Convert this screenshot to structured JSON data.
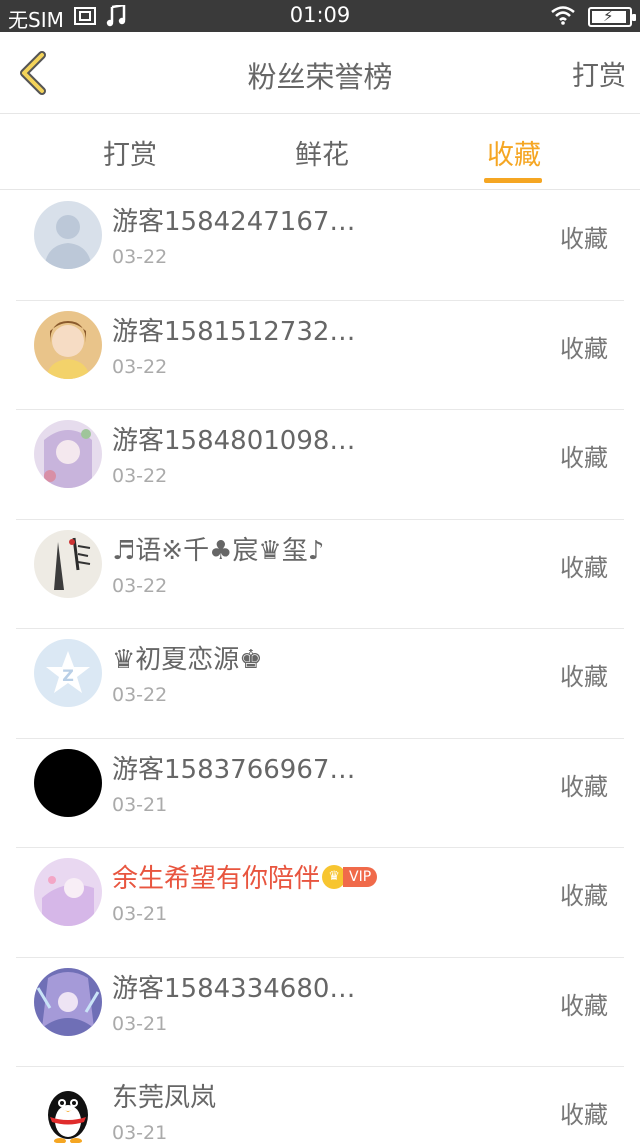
{
  "status_bar": {
    "carrier": "无SIM",
    "time": "01:09",
    "battery_level": 0.95
  },
  "header": {
    "title": "粉丝荣誉榜",
    "right_link": "打赏",
    "back_icon": "chevron-left-icon"
  },
  "tabs": [
    {
      "label": "打赏",
      "active": false
    },
    {
      "label": "鲜花",
      "active": false
    },
    {
      "label": "收藏",
      "active": true
    }
  ],
  "colors": {
    "accent": "#f5a623",
    "vip_name": "#e8553f",
    "status_bar": "#3a3a3a"
  },
  "fans": [
    {
      "name": "游客1584247167…",
      "date": "03-22",
      "action": "收藏",
      "avatar": "default-user-avatar"
    },
    {
      "name": "游客1581512732…",
      "date": "03-22",
      "action": "收藏",
      "avatar": "girl-photo-avatar"
    },
    {
      "name": "游客1584801098…",
      "date": "03-22",
      "action": "收藏",
      "avatar": "anime-purple-avatar"
    },
    {
      "name": "♬语※千♣宸♛玺♪",
      "date": "03-22",
      "action": "收藏",
      "avatar": "ink-painting-avatar"
    },
    {
      "name": "♛初夏恋源♚",
      "date": "03-22",
      "action": "收藏",
      "avatar": "qzone-star-avatar"
    },
    {
      "name": "游客1583766967…",
      "date": "03-21",
      "action": "收藏",
      "avatar": "black-avatar"
    },
    {
      "name": "余生希望有你陪伴",
      "date": "03-21",
      "action": "收藏",
      "avatar": "pink-anime-avatar",
      "vip": "VIP"
    },
    {
      "name": "游客1584334680…",
      "date": "03-21",
      "action": "收藏",
      "avatar": "blue-anime-avatar"
    },
    {
      "name": "东莞凤岚",
      "date": "03-21",
      "action": "收藏",
      "avatar": "qq-penguin-avatar"
    }
  ]
}
